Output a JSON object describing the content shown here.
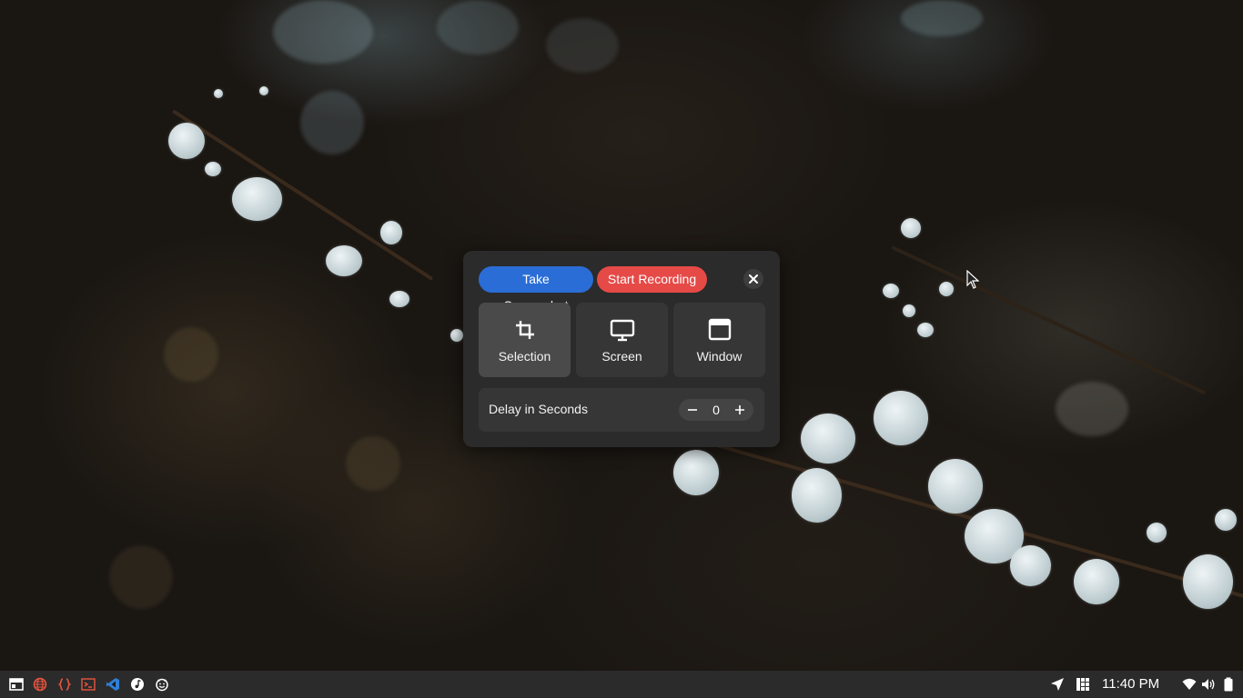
{
  "dialog": {
    "take_screenshot_label": "Take Screenshot",
    "start_recording_label": "Start Recording",
    "close_icon": "close-icon",
    "modes": [
      {
        "label": "Selection",
        "icon": "crop-icon",
        "selected": true
      },
      {
        "label": "Screen",
        "icon": "monitor-icon",
        "selected": false
      },
      {
        "label": "Window",
        "icon": "window-icon",
        "selected": false
      }
    ],
    "delay": {
      "label": "Delay in Seconds",
      "value": "0",
      "decrement_icon": "minus-icon",
      "increment_icon": "plus-icon"
    },
    "colors": {
      "screenshot_accent": "#2a6dd6",
      "recording_accent": "#e64a47"
    }
  },
  "taskbar": {
    "left_icons": [
      "app-menu-icon",
      "globe-icon",
      "code-braces-icon",
      "terminal-icon",
      "vscode-icon",
      "music-icon",
      "emoji-icon"
    ],
    "right_icons": [
      "send-icon",
      "grid-icon",
      "wifi-icon",
      "volume-icon",
      "battery-icon"
    ],
    "clock": "11:40 PM"
  }
}
